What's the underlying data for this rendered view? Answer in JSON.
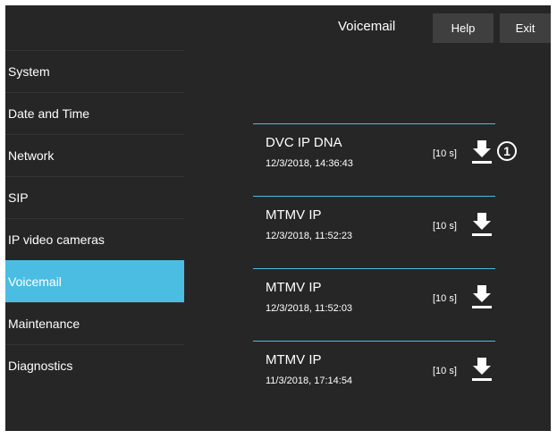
{
  "header": {
    "title": "Voicemail",
    "help_label": "Help",
    "exit_label": "Exit"
  },
  "sidebar": {
    "items": [
      {
        "label": "System",
        "active": false
      },
      {
        "label": "Date and Time",
        "active": false
      },
      {
        "label": "Network",
        "active": false
      },
      {
        "label": "SIP",
        "active": false
      },
      {
        "label": "IP video cameras",
        "active": false
      },
      {
        "label": "Voicemail",
        "active": true
      },
      {
        "label": "Maintenance",
        "active": false
      },
      {
        "label": "Diagnostics",
        "active": false
      }
    ]
  },
  "voicemails": [
    {
      "name": "DVC IP DNA",
      "date": "12/3/2018, 14:36:43",
      "duration": "[10 s]",
      "icon": "download-icon"
    },
    {
      "name": "MTMV IP",
      "date": "12/3/2018, 11:52:23",
      "duration": "[10 s]",
      "icon": "download-icon"
    },
    {
      "name": "MTMV IP",
      "date": "12/3/2018, 11:52:03",
      "duration": "[10 s]",
      "icon": "download-icon"
    },
    {
      "name": "MTMV IP",
      "date": "11/3/2018, 17:14:54",
      "duration": "[10 s]",
      "icon": "download-icon"
    }
  ],
  "callout": {
    "label": "1"
  },
  "colors": {
    "background": "#262626",
    "accent": "#4bbde3",
    "button": "#3f3f3f"
  }
}
